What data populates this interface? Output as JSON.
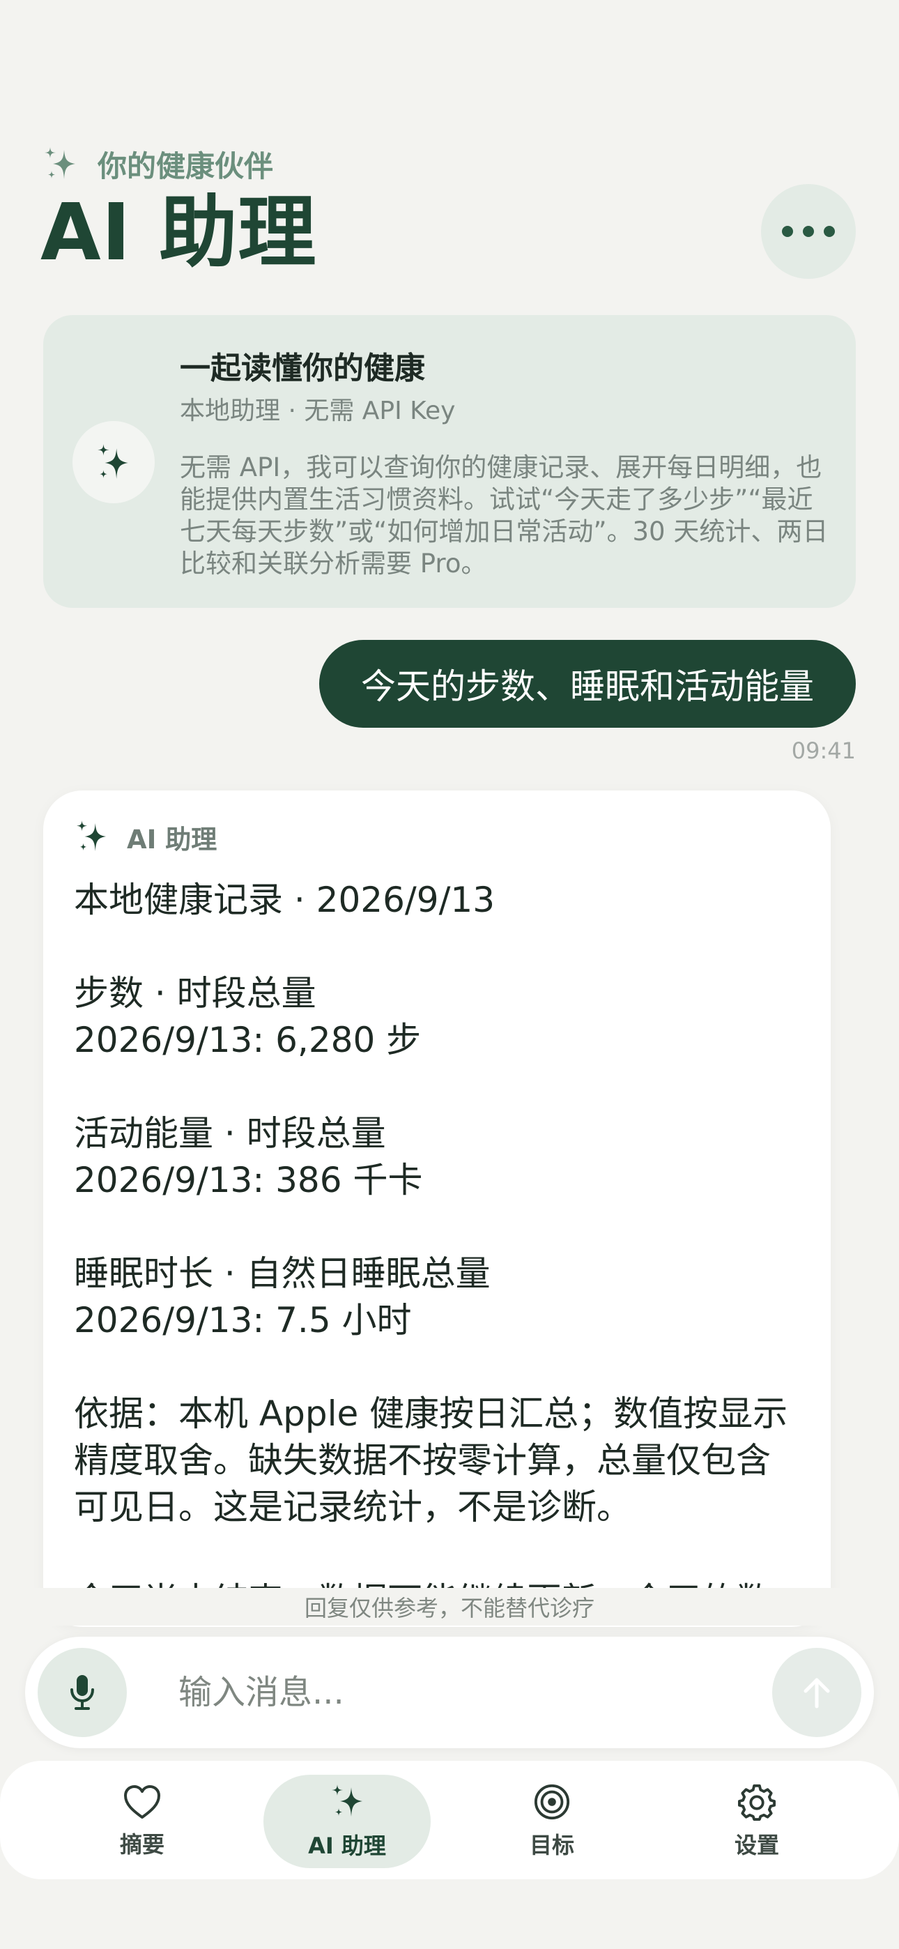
{
  "header": {
    "subtitle": "你的健康伙伴",
    "title": "AI 助理",
    "more_icon": "more-dots-icon"
  },
  "intro": {
    "heading": "一起读懂你的健康",
    "sub": "本地助理 · 无需 API Key",
    "body": "无需 API，我可以查询你的健康记录、展开每日明细，也能提供内置生活习惯资料。试试“今天走了多少步”“最近七天每天步数”或“如何增加日常活动”。30 天统计、两日比较和关联分析需要 Pro。"
  },
  "chat": {
    "user_message": "今天的步数、睡眠和活动能量",
    "user_time": "09:41",
    "ai_label": "AI 助理",
    "ai_lines": [
      "本地健康记录 · 2026/9/13",
      "",
      "步数 · 时段总量",
      "2026/9/13: 6,280 步",
      "",
      "活动能量 · 时段总量",
      "2026/9/13: 386 千卡",
      "",
      "睡眠时长 · 自然日睡眠总量",
      "2026/9/13: 7.5 小时",
      "",
      "依据：本机 Apple 健康按日汇总；数值按显示精度取舍。缺失数据不按零计算，总量仅包含可见日。这是记录统计，不是诊断。",
      "",
      "今天尚未结束，数据可能继续更新。今天的数"
    ]
  },
  "footer": {
    "disclaimer": "回复仅供参考，不能替代诊疗",
    "input_placeholder": "输入消息...",
    "mic_icon": "microphone-icon",
    "send_icon": "send-arrow-icon"
  },
  "tabs": [
    {
      "label": "摘要",
      "icon": "heart-icon",
      "active": false
    },
    {
      "label": "AI 助理",
      "icon": "sparkle-icon",
      "active": true
    },
    {
      "label": "目标",
      "icon": "target-icon",
      "active": false
    },
    {
      "label": "设置",
      "icon": "gear-icon",
      "active": false
    }
  ],
  "colors": {
    "accent": "#1f4634",
    "accent_soft": "#e3ebe5",
    "background": "#f3f3f0"
  }
}
